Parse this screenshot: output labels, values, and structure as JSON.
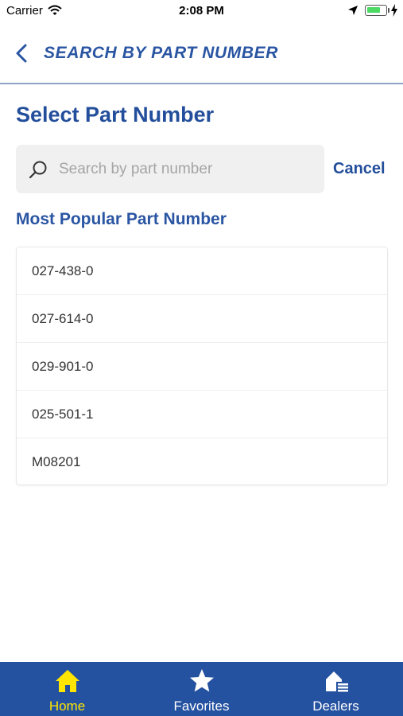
{
  "status_bar": {
    "carrier": "Carrier",
    "time": "2:08 PM",
    "battery_level": 0.75
  },
  "navbar": {
    "title": "SEARCH BY PART NUMBER",
    "back_icon": "chevron-left-icon"
  },
  "main": {
    "heading": "Select Part Number",
    "search": {
      "placeholder": "Search by part number",
      "value": "",
      "icon": "search-icon"
    },
    "cancel_label": "Cancel",
    "section_title": "Most Popular Part Number",
    "parts": [
      "027-438-0",
      "027-614-0",
      "029-901-0",
      "025-501-1",
      "M08201"
    ]
  },
  "tabbar": {
    "items": [
      {
        "label": "Home",
        "icon": "home-icon",
        "active": true
      },
      {
        "label": "Favorites",
        "icon": "star-icon",
        "active": false
      },
      {
        "label": "Dealers",
        "icon": "dealers-icon",
        "active": false
      }
    ]
  },
  "colors": {
    "brand_blue": "#234e9b",
    "tabbar_bg": "#2451a0",
    "active_tab": "#ffe500",
    "battery": "#4cd964"
  }
}
